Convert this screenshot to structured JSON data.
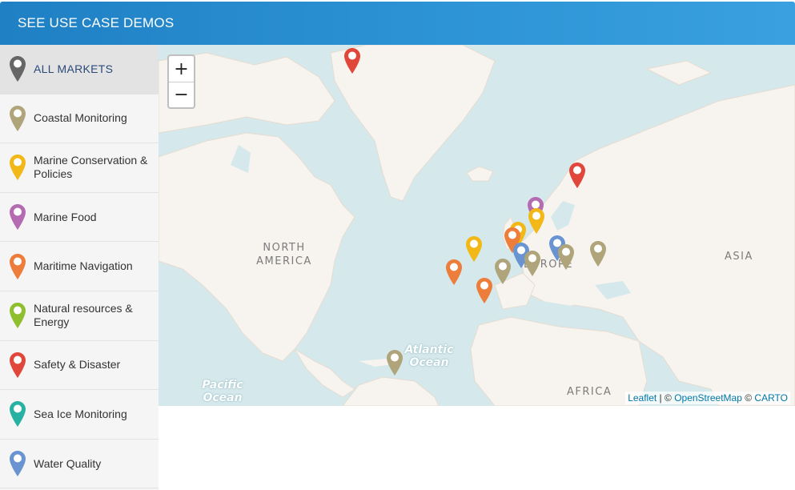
{
  "header": {
    "title": "SEE USE CASE DEMOS"
  },
  "colors": {
    "header": "#2a8fd3",
    "sidebar_active": "#e3e3e3",
    "water": "#d5e8eb",
    "land": "#f7f4ef"
  },
  "sidebar": {
    "items": [
      {
        "label": "ALL MARKETS",
        "color": "#666666",
        "active": true
      },
      {
        "label": "Coastal Monitoring",
        "color": "#b0a57a"
      },
      {
        "label": "Marine Conservation & Policies",
        "color": "#f2b818"
      },
      {
        "label": "Marine Food",
        "color": "#b46bb2"
      },
      {
        "label": "Maritime Navigation",
        "color": "#ec7d3a"
      },
      {
        "label": "Natural resources & Energy",
        "color": "#8fbf2e"
      },
      {
        "label": "Safety & Disaster",
        "color": "#e0473a"
      },
      {
        "label": "Sea Ice Monitoring",
        "color": "#27b1a3"
      },
      {
        "label": "Water Quality",
        "color": "#6a93d2"
      }
    ]
  },
  "map": {
    "zoom_in": "+",
    "zoom_out": "−",
    "labels": {
      "north_america": "NORTH AMERICA",
      "europe": "EUROPE",
      "asia": "ASIA",
      "africa": "AFRICA",
      "atlantic": "Atlantic Ocean",
      "pacific": "Pacific Ocean"
    },
    "attribution": {
      "leaflet": "Leaflet",
      "sep1": " | © ",
      "osm": "OpenStreetMap",
      "sep2": " © ",
      "carto": "CARTO"
    }
  }
}
